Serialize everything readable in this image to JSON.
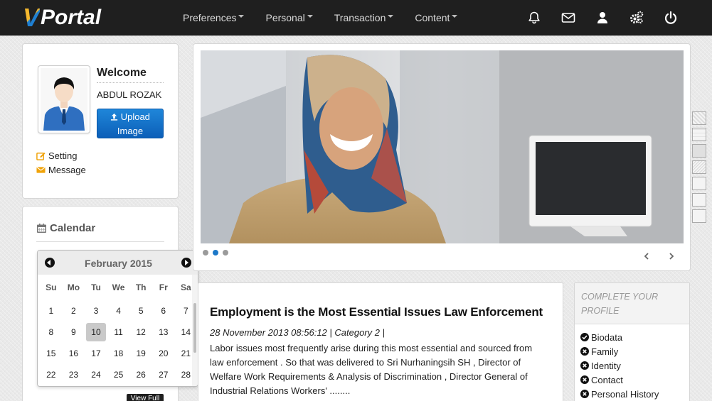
{
  "brand": {
    "v": "V",
    "name": "Portal"
  },
  "nav": {
    "menus": [
      "Preferences",
      "Personal",
      "Transaction",
      "Content"
    ],
    "icons": [
      "bell-icon",
      "envelope-icon",
      "user-icon",
      "gears-icon",
      "power-icon"
    ]
  },
  "profile": {
    "welcome": "Welcome",
    "name": "ABDUL ROZAK",
    "upload_line1": "Upload",
    "upload_line2": "Image",
    "setting": "Setting",
    "message": "Message"
  },
  "calendar": {
    "title": "Calendar",
    "month": "February 2015",
    "weekdays": [
      "Su",
      "Mo",
      "Tu",
      "We",
      "Th",
      "Fr",
      "Sa"
    ],
    "weeks": [
      [
        "1",
        "2",
        "3",
        "4",
        "5",
        "6",
        "7"
      ],
      [
        "8",
        "9",
        "10",
        "11",
        "12",
        "13",
        "14"
      ],
      [
        "15",
        "16",
        "17",
        "18",
        "19",
        "20",
        "21"
      ],
      [
        "22",
        "23",
        "24",
        "25",
        "26",
        "27",
        "28"
      ]
    ],
    "today": "10",
    "view_full": "View Full"
  },
  "slider": {
    "slide_count": 3,
    "active_slide": 2
  },
  "news": {
    "title": "Employment is the Most Essential Issues Law Enforcement",
    "meta": "28 November 2013 08:56:12 | Category 2 |",
    "body": "Labor issues most frequently arise during this most essential and sourced from law enforcement . So that was delivered to Sri Nurhaningsih SH , Director of Welfare Work Requirements & Analysis of Discrimination , Director General of Industrial Relations Workers' ........"
  },
  "complete_profile": {
    "heading": "COMPLETE YOUR PROFILE",
    "items": [
      {
        "label": "Biodata",
        "done": true
      },
      {
        "label": "Family",
        "done": false
      },
      {
        "label": "Identity",
        "done": false
      },
      {
        "label": "Contact",
        "done": false
      },
      {
        "label": "Personal History",
        "done": false
      }
    ]
  },
  "colors": {
    "navbar": "#1f1f1f",
    "accent_blue": "#1c78c8",
    "brand_orange": "#f5b82e",
    "icon_orange": "#f0a30a"
  }
}
